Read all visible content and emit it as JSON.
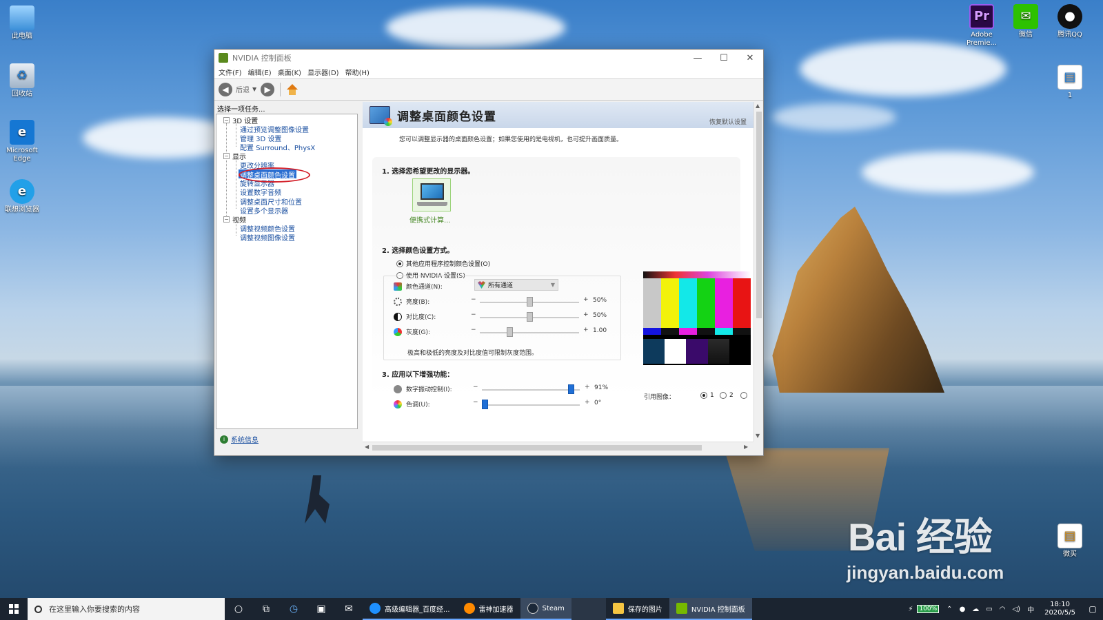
{
  "desktop": {
    "icons_left": [
      "此电脑",
      "回收站",
      "Microsoft Edge",
      "联想浏览器"
    ],
    "icons_right": [
      "Adobe Premie...",
      "微信",
      "腾讯QQ",
      "1",
      "微买"
    ]
  },
  "window": {
    "title": "NVIDIA 控制面板",
    "menu": [
      "文件(F)",
      "编辑(E)",
      "桌面(K)",
      "显示器(D)",
      "帮助(H)"
    ],
    "toolbar": {
      "back_label": "后退"
    },
    "task_pane": {
      "title": "选择一项任务...",
      "groups": [
        {
          "label": "3D 设置",
          "items": [
            "通过预览调整图像设置",
            "管理 3D 设置",
            "配置 Surround、PhysX"
          ]
        },
        {
          "label": "显示",
          "items": [
            "更改分辨率",
            "调整桌面颜色设置",
            "旋转显示器",
            "设置数字音频",
            "调整桌面尺寸和位置",
            "设置多个显示器"
          ]
        },
        {
          "label": "视频",
          "items": [
            "调整视频颜色设置",
            "调整视频图像设置"
          ]
        }
      ],
      "selected": "调整桌面颜色设置",
      "sysinfo": "系统信息"
    },
    "content": {
      "title": "调整桌面颜色设置",
      "restore": "恢复默认设置",
      "description": "您可以调整显示器的桌面颜色设置；如果您使用的是电视机，也可提升画面质量。",
      "step1": "1.  选择您希望更改的显示器。",
      "monitor_label": "便携式计算...",
      "step2": "2.  选择颜色设置方式。",
      "radio_other": "其他应用程序控制颜色设置(O)",
      "radio_nvidia": "使用 NVIDIA 设置(S)",
      "channel_label": "颜色通道(N):",
      "channel_value": "所有通道",
      "brightness_label": "亮度(B):",
      "brightness_value": "50%",
      "brightness_level": 0.5,
      "contrast_label": "对比度(C):",
      "contrast_value": "50%",
      "contrast_level": 0.5,
      "gamma_label": "灰度(G):",
      "gamma_value": "1.00",
      "gamma_level": 0.3,
      "note": "极高和极低的亮度及对比度值可限制灰度范围。",
      "step3": "3.  应用以下增强功能：",
      "vibrance_label": "数字振动控制(I):",
      "vibrance_value": "91%",
      "vibrance_level": 0.91,
      "hue_label": "色调(U):",
      "hue_value": "0°",
      "hue_level": 0.0,
      "ref_label": "引用图像：",
      "ref_options": [
        "1",
        "2",
        ""
      ],
      "minus": "−",
      "plus": "+"
    }
  },
  "taskbar": {
    "search_placeholder": "在这里输入你要搜索的内容",
    "apps": [
      "高级编辑器_百度经...",
      "雷神加速器",
      "Steam",
      "保存的图片",
      "NVIDIA 控制面板"
    ],
    "battery": "100%",
    "ime": "中",
    "time": "18:10",
    "date": "2020/5/5"
  },
  "watermark": {
    "brand": "Bai 经验",
    "url": "jingyan.baidu.com"
  },
  "colors": {
    "accent_blue": "#2a6ed1",
    "nvidia_green": "#76b900",
    "highlight_red": "#d3202a",
    "taskbar": "#1b2430"
  }
}
